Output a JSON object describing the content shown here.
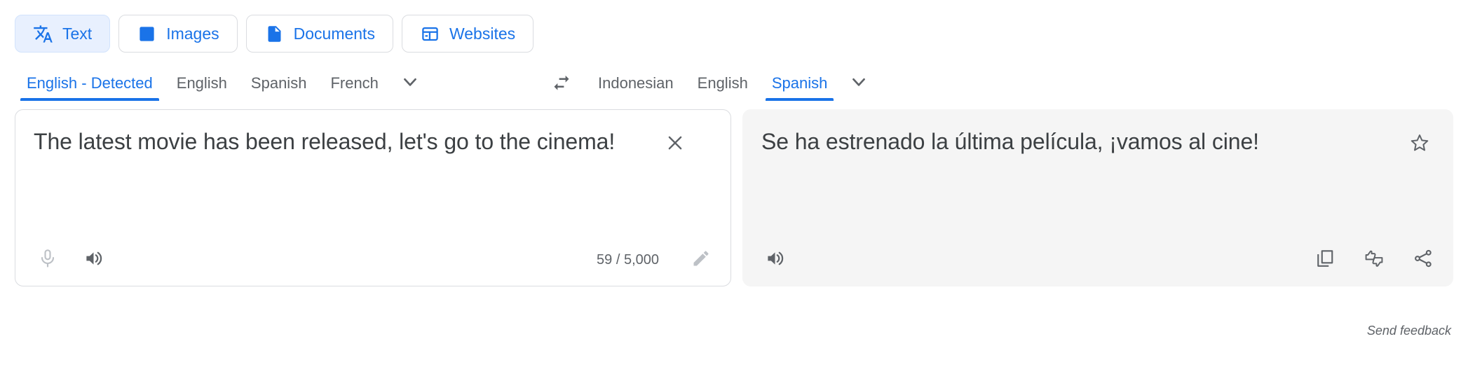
{
  "modes": [
    {
      "label": "Text",
      "icon": "translate-icon",
      "active": true
    },
    {
      "label": "Images",
      "icon": "image-icon",
      "active": false
    },
    {
      "label": "Documents",
      "icon": "document-icon",
      "active": false
    },
    {
      "label": "Websites",
      "icon": "website-icon",
      "active": false
    }
  ],
  "source_languages": {
    "tabs": [
      {
        "label": "English - Detected",
        "selected": true
      },
      {
        "label": "English",
        "selected": false
      },
      {
        "label": "Spanish",
        "selected": false
      },
      {
        "label": "French",
        "selected": false
      }
    ],
    "more_icon": "chevron-down-icon"
  },
  "swap": {
    "icon": "swap-horizontal-icon"
  },
  "target_languages": {
    "tabs": [
      {
        "label": "Indonesian",
        "selected": false
      },
      {
        "label": "English",
        "selected": false
      },
      {
        "label": "Spanish",
        "selected": true
      }
    ],
    "more_icon": "chevron-down-icon"
  },
  "source_panel": {
    "text": "The latest movie has been released, let's go to the cinema!",
    "clear_icon": "close-icon",
    "mic_icon": "microphone-icon",
    "speaker_icon": "volume-up-icon",
    "char_count": "59 / 5,000",
    "edit_icon": "pencil-icon"
  },
  "target_panel": {
    "text": "Se ha estrenado la última película, ¡vamos al cine!",
    "star_icon": "star-outline-icon",
    "speaker_icon": "volume-up-icon",
    "copy_icon": "copy-icon",
    "rate_icon": "thumbs-updown-icon",
    "share_icon": "share-icon"
  },
  "footer": {
    "send_feedback": "Send feedback"
  },
  "colors": {
    "accent": "#1a73e8",
    "accent_bg": "#e8f0fe",
    "text": "#3c4043",
    "muted": "#5f6368",
    "border": "#dadce0",
    "panel_bg": "#f5f5f5"
  }
}
